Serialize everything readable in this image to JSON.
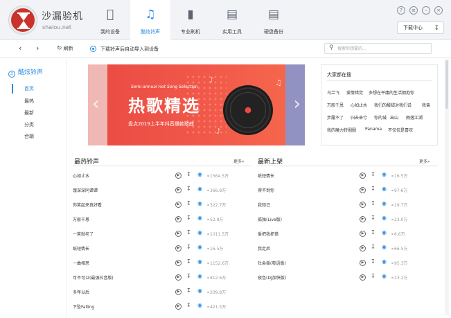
{
  "app": {
    "name": "沙漏验机",
    "domain": "shalou.net"
  },
  "nav_tabs": [
    {
      "label": "我的设备",
      "icon": "apple-icon"
    },
    {
      "label": "酷炫铃声",
      "icon": "music-note-icon"
    },
    {
      "label": "专业刷机",
      "icon": "phone-flash-icon"
    },
    {
      "label": "实用工具",
      "icon": "toolbox-icon"
    },
    {
      "label": "硬盘备份",
      "icon": "disk-backup-icon"
    }
  ],
  "window_controls": [
    "help-icon",
    "menu-icon",
    "minimize-icon",
    "close-icon"
  ],
  "download_center": "下载中心",
  "toolbar": {
    "refresh": "刷新",
    "auto_import": "下载铃声后自动导入到设备",
    "search_placeholder": "搜索你想要的..."
  },
  "sidebar": {
    "title": "酷炫铃声",
    "items": [
      "首页",
      "最热",
      "最新",
      "分类",
      "合辑"
    ]
  },
  "banner": {
    "small_text": "Semi-annual Hot Song Selection",
    "title": "热歌精选",
    "subtitle": "盘点2019上半年抖音爆款歌曲"
  },
  "trending": {
    "title": "大家都在搜",
    "tags": [
      "乌兰飞",
      "爱情错觉",
      "多想在平庸的生活拥抱你",
      "万般千恩",
      "心如止水",
      "我们的酸甜对我们说",
      "我曾",
      "步履不了",
      "归去来兮",
      "你的城",
      "出山",
      "雨落江湖",
      "我的魔力转圈圈",
      "Panama",
      "不仅仅是喜欢"
    ]
  },
  "hot_list": {
    "title": "最热铃声",
    "more": "更多»",
    "items": [
      {
        "name": "心如止水",
        "count": "1564.5万"
      },
      {
        "name": "饿深深同谭谭",
        "count": "366.8万"
      },
      {
        "name": "你笑起来真好看",
        "count": "322.7万"
      },
      {
        "name": "万般千恩",
        "count": "52.9万"
      },
      {
        "name": "一笑就老了",
        "count": "1011.5万"
      },
      {
        "name": "纸短情长",
        "count": "16.5万"
      },
      {
        "name": "一曲相思",
        "count": "1152.6万"
      },
      {
        "name": "可不可以(最强抖音版)",
        "count": "812.6万"
      },
      {
        "name": "多年以后",
        "count": "209.8万"
      },
      {
        "name": "下坠Falling",
        "count": "421.5万"
      }
    ]
  },
  "new_list": {
    "title": "最新上架",
    "more": "更多»",
    "items": [
      {
        "name": "纸短情长",
        "count": "16.5万"
      },
      {
        "name": "得不到你",
        "count": "97.6万"
      },
      {
        "name": "我知己",
        "count": "29.7万"
      },
      {
        "name": "孤独(Live版)",
        "count": "23.0万"
      },
      {
        "name": "爱把我抓错",
        "count": "6.6万"
      },
      {
        "name": "我走后",
        "count": "66.5万"
      },
      {
        "name": "社会摇(粤语版)",
        "count": "95.3万"
      },
      {
        "name": "夜色(DJ加快版)",
        "count": "23.2万"
      }
    ]
  },
  "colors": {
    "accent": "#2b8de0",
    "banner": "#e94a43"
  }
}
